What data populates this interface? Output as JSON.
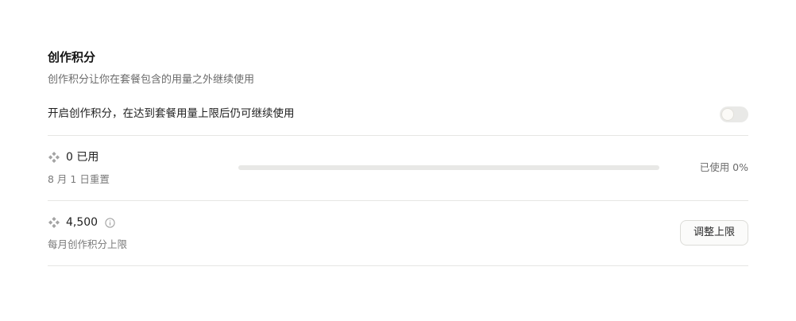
{
  "section": {
    "title": "创作积分",
    "description": "创作积分让你在套餐包含的用量之外继续使用"
  },
  "toggle": {
    "label": "开启创作积分，在达到套餐用量上限后仍可继续使用",
    "enabled": false
  },
  "usage": {
    "used_label": "0 已用",
    "reset_text": "8 月 1 日重置",
    "progress_text": "已使用 0%",
    "progress_fraction": 0
  },
  "limit": {
    "value_label": "4,500",
    "sub_label": "每月创作积分上限",
    "adjust_button": "调整上限"
  },
  "icons": {
    "credit": "sparkle-diamond-icon",
    "info": "info-circle-icon"
  },
  "colors": {
    "icon_gray": "#a3a3a3",
    "track": "#e8e8e6",
    "accent": "#c6613f"
  }
}
